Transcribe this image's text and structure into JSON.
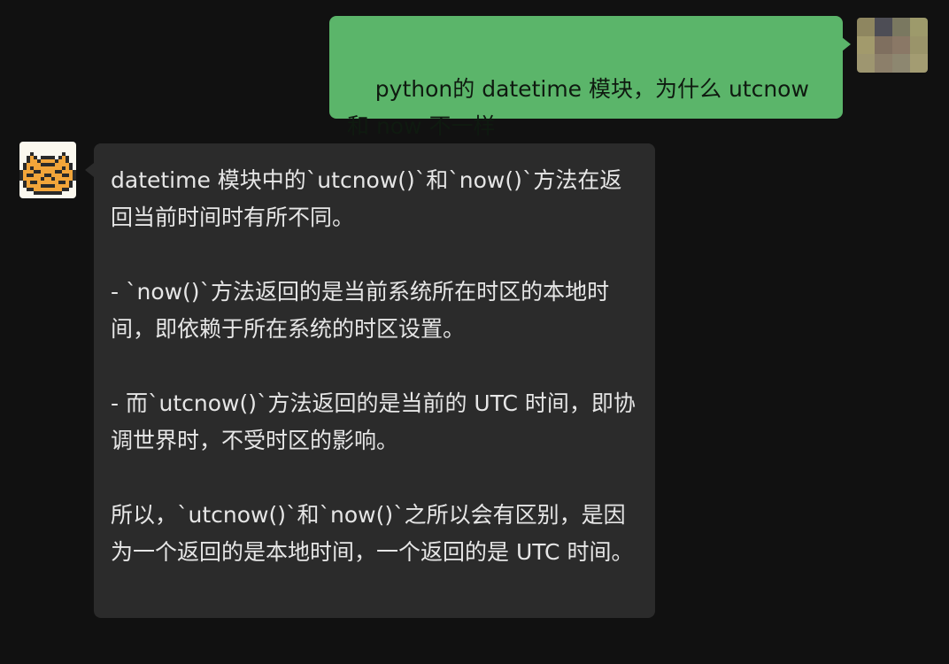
{
  "messages": {
    "user": {
      "text": "python的 datetime 模块，为什么 utcnow 和 now 不一样",
      "avatar_colors": [
        "#8e8660",
        "#4d4d55",
        "#7a7860",
        "#9d9a6b",
        "#a29a6c",
        "#7f6f5f",
        "#8a7866",
        "#9a946a",
        "#9e9670",
        "#8c7f6a",
        "#8d8770",
        "#a39c72"
      ]
    },
    "bot": {
      "paragraphs": [
        "datetime 模块中的`utcnow()`和`now()`方法在返回当前时间时有所不同。",
        "- `now()`方法返回的是当前系统所在时区的本地时间，即依赖于所在系统的时区设置。",
        "- 而`utcnow()`方法返回的是当前的 UTC 时间，即协调世界时，不受时区的影响。",
        "所以，`utcnow()`和`now()`之所以会有区别，是因为一个返回的是本地时间，一个返回的是 UTC 时间。"
      ],
      "avatar_colors": {
        "fur": "#f2a53a",
        "stripe": "#2a2a2a",
        "background": "#fbf8ee"
      }
    }
  }
}
